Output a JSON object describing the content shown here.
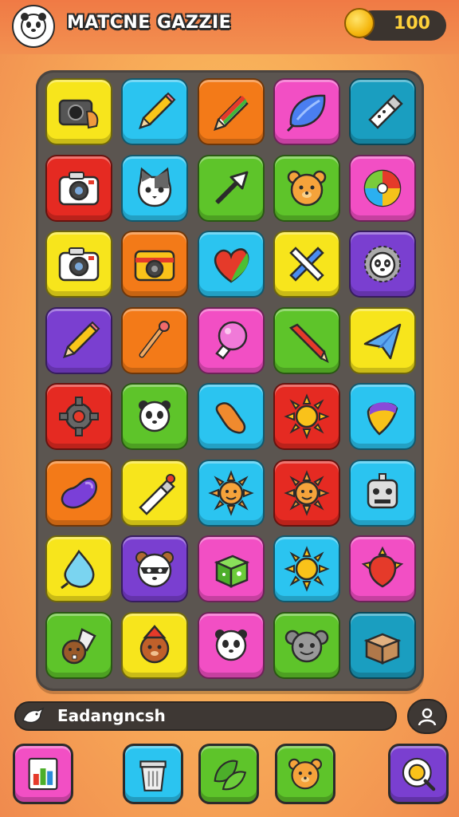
{
  "header": {
    "title": "MATCNE GAZZIE",
    "coins": "100"
  },
  "colors": {
    "yellow": "#f7e51c",
    "cyan": "#2bc4f0",
    "orange": "#f37a18",
    "pink": "#f24fc4",
    "teal": "#1a9ec0",
    "red": "#e52a22",
    "green": "#5ec42a",
    "purple": "#7a3fd0"
  },
  "board": {
    "rows": [
      [
        {
          "color": "yellow",
          "icon": "camera-hand-icon"
        },
        {
          "color": "cyan",
          "icon": "pencil-icon"
        },
        {
          "color": "orange",
          "icon": "rainbow-pencil-icon"
        },
        {
          "color": "pink",
          "icon": "blue-leaf-icon"
        },
        {
          "color": "teal",
          "icon": "usb-stick-icon"
        }
      ],
      [
        {
          "color": "red",
          "icon": "camera-icon"
        },
        {
          "color": "cyan",
          "icon": "cat-face-icon"
        },
        {
          "color": "green",
          "icon": "arrow-icon"
        },
        {
          "color": "green",
          "icon": "bear-face-icon"
        },
        {
          "color": "pink",
          "icon": "swirl-candy-icon"
        }
      ],
      [
        {
          "color": "yellow",
          "icon": "camera-icon"
        },
        {
          "color": "orange",
          "icon": "retro-camera-icon"
        },
        {
          "color": "cyan",
          "icon": "heart-icon"
        },
        {
          "color": "yellow",
          "icon": "crossed-pencils-icon"
        },
        {
          "color": "purple",
          "icon": "panda-sun-icon"
        }
      ],
      [
        {
          "color": "purple",
          "icon": "pencil-icon"
        },
        {
          "color": "orange",
          "icon": "wand-icon"
        },
        {
          "color": "pink",
          "icon": "lightbulb-icon"
        },
        {
          "color": "green",
          "icon": "red-pencil-icon"
        },
        {
          "color": "yellow",
          "icon": "paper-plane-icon"
        }
      ],
      [
        {
          "color": "red",
          "icon": "gear-icon"
        },
        {
          "color": "green",
          "icon": "panda-icon"
        },
        {
          "color": "cyan",
          "icon": "bean-icon"
        },
        {
          "color": "red",
          "icon": "sun-icon"
        },
        {
          "color": "cyan",
          "icon": "spinning-top-icon"
        }
      ],
      [
        {
          "color": "orange",
          "icon": "jellybean-icon"
        },
        {
          "color": "yellow",
          "icon": "marker-icon"
        },
        {
          "color": "cyan",
          "icon": "sun-face-icon"
        },
        {
          "color": "red",
          "icon": "sun-face-icon"
        },
        {
          "color": "cyan",
          "icon": "robot-icon"
        }
      ],
      [
        {
          "color": "yellow",
          "icon": "water-drop-icon"
        },
        {
          "color": "purple",
          "icon": "raccoon-icon"
        },
        {
          "color": "pink",
          "icon": "dice-icon"
        },
        {
          "color": "cyan",
          "icon": "sun-icon"
        },
        {
          "color": "pink",
          "icon": "red-balloon-icon"
        }
      ],
      [
        {
          "color": "green",
          "icon": "beaver-icon"
        },
        {
          "color": "yellow",
          "icon": "dog-hat-icon"
        },
        {
          "color": "pink",
          "icon": "panda-icon"
        },
        {
          "color": "green",
          "icon": "koala-icon"
        },
        {
          "color": "teal",
          "icon": "box-icon"
        }
      ]
    ]
  },
  "chat": {
    "text": "Eadangncsh"
  },
  "bottom_bar": [
    {
      "color": "pink",
      "icon": "chart-card-icon"
    },
    {
      "color": "cyan",
      "icon": "trash-bin-icon"
    },
    {
      "color": "green",
      "icon": "leaves-icon"
    },
    {
      "color": "green",
      "icon": "bear-face-icon"
    },
    {
      "color": "purple",
      "icon": "search-bubble-icon"
    }
  ]
}
